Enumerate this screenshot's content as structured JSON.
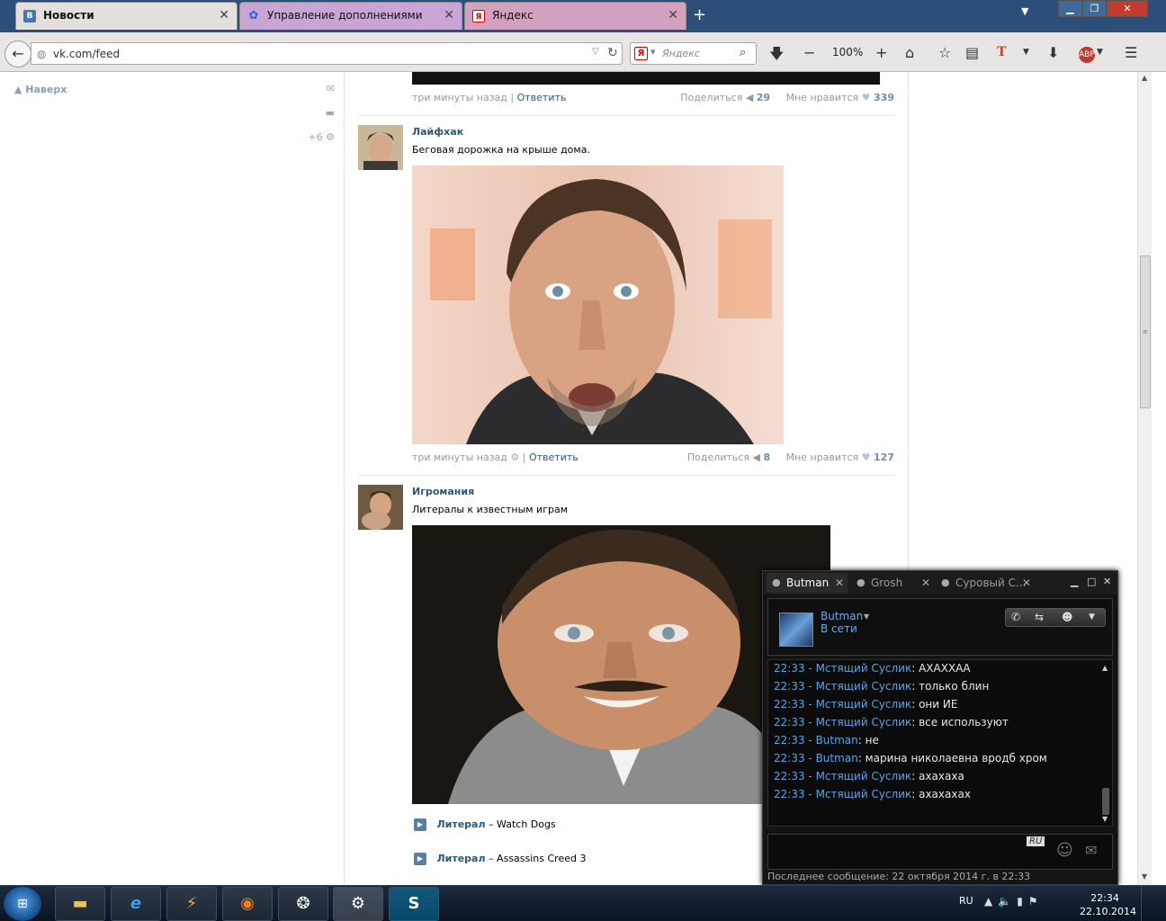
{
  "browser": {
    "tabs": [
      {
        "label": "Новости",
        "favicon": "В"
      },
      {
        "label": "Управление дополнениями",
        "favicon": "✿"
      },
      {
        "label": "Яндекс",
        "favicon": "Я"
      }
    ],
    "url": "vk.com/feed",
    "search_placeholder": "Яндекс",
    "search_logo": "Я",
    "zoom": "100%"
  },
  "sidebar": {
    "up_label": "Наверх",
    "settings_count": "+6"
  },
  "feed": {
    "top_post": {
      "time": "три минуты назад",
      "reply": "Ответить",
      "share_label": "Поделиться",
      "share_count": "29",
      "like_label": "Мне нравится",
      "like_count": "339"
    },
    "posts": [
      {
        "author": "Лайфхак",
        "text": "Беговая дорожка на крыше дома.",
        "time": "три минуты назад",
        "reply": "Ответить",
        "share_label": "Поделиться",
        "share_count": "8",
        "like_label": "Мне нравится",
        "like_count": "127"
      },
      {
        "author": "Игромания",
        "text": "Литералы к известным играм",
        "attachments": [
          {
            "link": "Литерал",
            "title": "– Watch Dogs"
          },
          {
            "link": "Литерал",
            "title": "– Assassins Creed 3"
          }
        ]
      }
    ]
  },
  "chat": {
    "tabs": [
      "Butman",
      "Grosh",
      "Суровый С..."
    ],
    "contact_name": "Butman",
    "contact_status": "В сети",
    "messages": [
      {
        "time": "22:33",
        "sender": "Мстящий Суслик",
        "text": "АХАХХАА"
      },
      {
        "time": "22:33",
        "sender": "Мстящий Суслик",
        "text": "только блин"
      },
      {
        "time": "22:33",
        "sender": "Мстящий Суслик",
        "text": "они ИЕ"
      },
      {
        "time": "22:33",
        "sender": "Мстящий Суслик",
        "text": "все используют"
      },
      {
        "time": "22:33",
        "sender": "Butman",
        "text": "не"
      },
      {
        "time": "22:33",
        "sender": "Butman",
        "text": "марина николаевна вродб хром"
      },
      {
        "time": "22:33",
        "sender": "Мстящий Суслик",
        "text": "ахахаха"
      },
      {
        "time": "22:33",
        "sender": "Мстящий Суслик",
        "text": "ахахахах"
      }
    ],
    "input_lang": "RU",
    "last_message": "Последнее сообщение: 22 октября 2014 г. в 22:33"
  },
  "taskbar": {
    "language": "RU",
    "time": "22:34",
    "date": "22.10.2014"
  }
}
